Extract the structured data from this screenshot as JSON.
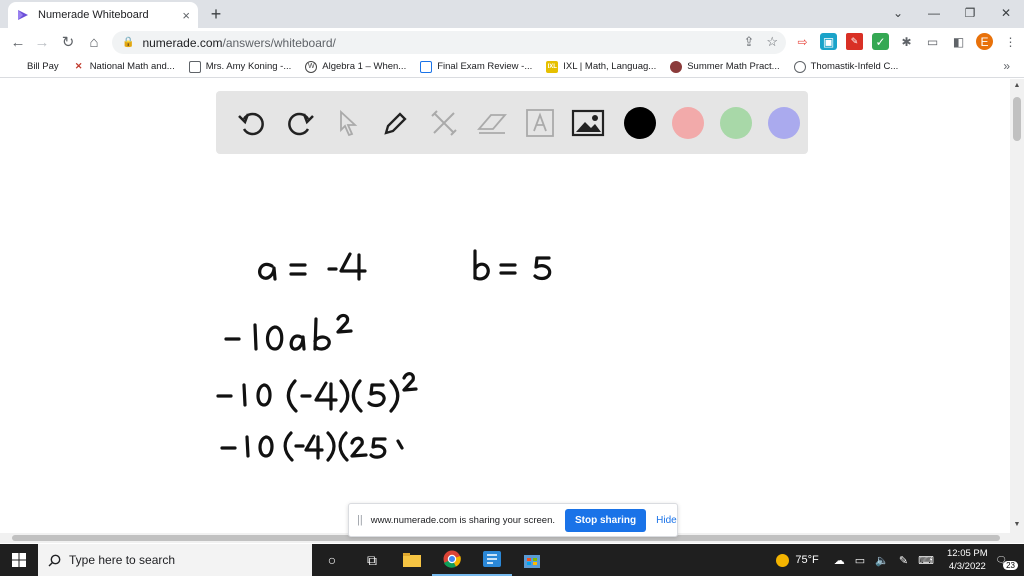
{
  "browser": {
    "tab_title": "Numerade Whiteboard",
    "tab_close": "×",
    "new_tab": "+",
    "url_host": "numerade.com",
    "url_path": "/answers/whiteboard/",
    "profile_initial": "E",
    "window_controls": {
      "minimize": "—",
      "restore": "❐",
      "close": "✕",
      "dropdown": "⌄"
    }
  },
  "bookmarks": [
    {
      "label": "Bill Pay",
      "icon": "bookmark-icon"
    },
    {
      "label": "National Math and...",
      "icon": "x-logo-icon"
    },
    {
      "label": "Mrs. Amy Koning -...",
      "icon": "page-icon"
    },
    {
      "label": "Algebra 1 – When...",
      "icon": "wordpress-icon"
    },
    {
      "label": "Final Exam Review -...",
      "icon": "form-icon"
    },
    {
      "label": "IXL | Math, Languag...",
      "icon": "ixl-icon"
    },
    {
      "label": "Summer Math Pract...",
      "icon": "circle-logo-icon"
    },
    {
      "label": "Thomastik-Infeld C...",
      "icon": "globe-icon"
    }
  ],
  "bookmarks_more": "»",
  "whiteboard": {
    "tools": [
      "undo-icon",
      "redo-icon",
      "pointer-icon",
      "pen-icon",
      "tools-icon",
      "eraser-icon",
      "text-icon",
      "image-icon"
    ],
    "colors": [
      "#000000",
      "#f2aaaa",
      "#a8d8a8",
      "#aaaaee"
    ],
    "handwriting": {
      "line1_a": "a = -4",
      "line1_b": "b = 5",
      "line2": "-10ab²",
      "line3": "-10(-4)(5)²",
      "line4": "-10(-4)(25"
    }
  },
  "sharebar": {
    "grip": "||",
    "message": "www.numerade.com is sharing your screen.",
    "stop_label": "Stop sharing",
    "hide_label": "Hide"
  },
  "taskbar": {
    "search_placeholder": "Type here to search",
    "temperature": "75°F",
    "time": "12:05 PM",
    "date": "4/3/2022",
    "notification_count": "23"
  }
}
